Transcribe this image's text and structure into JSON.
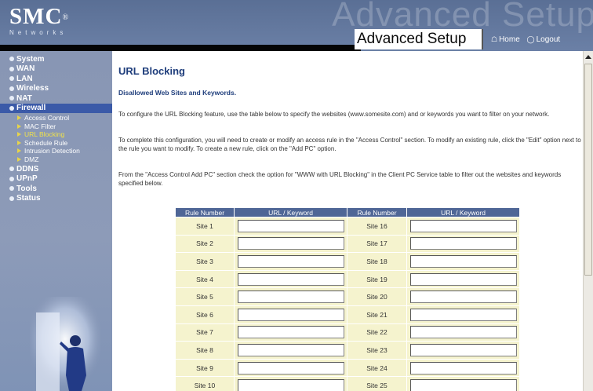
{
  "header": {
    "brand": "SMC",
    "brand_mark": "®",
    "brand_sub": "Networks",
    "watermark": "Advanced Setup",
    "title": "Advanced Setup",
    "home_label": "Home",
    "logout_label": "Logout"
  },
  "sidebar": {
    "items_top": [
      {
        "label": "System"
      },
      {
        "label": "WAN"
      },
      {
        "label": "LAN"
      },
      {
        "label": "Wireless"
      },
      {
        "label": "NAT"
      },
      {
        "label": "Firewall"
      }
    ],
    "firewall_sub": [
      {
        "label": "Access Control"
      },
      {
        "label": "MAC Filter"
      },
      {
        "label": "URL Blocking"
      },
      {
        "label": "Schedule Rule"
      },
      {
        "label": "Intrusion Detection"
      },
      {
        "label": "DMZ"
      }
    ],
    "items_bottom": [
      {
        "label": "DDNS"
      },
      {
        "label": "UPnP"
      },
      {
        "label": "Tools"
      },
      {
        "label": "Status"
      }
    ]
  },
  "content": {
    "title": "URL Blocking",
    "section_title": "Disallowed Web Sites and Keywords.",
    "para1": "To configure the URL Blocking feature, use the table below to specify the websites (www.somesite.com) and or keywords you want to filter on your network.",
    "para2": "To complete this configuration, you will need to create or modify an access rule in the \"Access Control\" section. To modify an existing rule, click the \"Edit\" option next to the rule you want to modify. To create a new rule, click on the \"Add PC\" option.",
    "para3": "From the \"Access Control Add PC\" section check the option for \"WWW with URL Blocking\" in the Client PC Service table to filter out the websites and keywords specified below."
  },
  "table": {
    "headers": [
      "Rule Number",
      "URL / Keyword",
      "Rule Number",
      "URL / Keyword"
    ],
    "rows": [
      {
        "left": "Site  1",
        "left_value": "",
        "right": "Site  16",
        "right_value": ""
      },
      {
        "left": "Site  2",
        "left_value": "",
        "right": "Site  17",
        "right_value": ""
      },
      {
        "left": "Site  3",
        "left_value": "",
        "right": "Site  18",
        "right_value": ""
      },
      {
        "left": "Site  4",
        "left_value": "",
        "right": "Site  19",
        "right_value": ""
      },
      {
        "left": "Site  5",
        "left_value": "",
        "right": "Site  20",
        "right_value": ""
      },
      {
        "left": "Site  6",
        "left_value": "",
        "right": "Site  21",
        "right_value": ""
      },
      {
        "left": "Site  7",
        "left_value": "",
        "right": "Site  22",
        "right_value": ""
      },
      {
        "left": "Site  8",
        "left_value": "",
        "right": "Site  23",
        "right_value": ""
      },
      {
        "left": "Site  9",
        "left_value": "",
        "right": "Site  24",
        "right_value": ""
      },
      {
        "left": "Site  10",
        "left_value": "",
        "right": "Site  25",
        "right_value": ""
      }
    ]
  },
  "colors": {
    "header_bg": "#5a6f95",
    "sidebar_bg": "#8896b4",
    "table_header_bg": "#4f6696",
    "table_cell_bg": "#f5f3ce",
    "title_color": "#1e3d7b",
    "subnav_current": "#f0e24a"
  },
  "icons": {
    "home": "home-icon",
    "logout": "logout-icon",
    "bullet": "nav-bullet-icon",
    "submenu": "submenu-arrow-icon"
  }
}
